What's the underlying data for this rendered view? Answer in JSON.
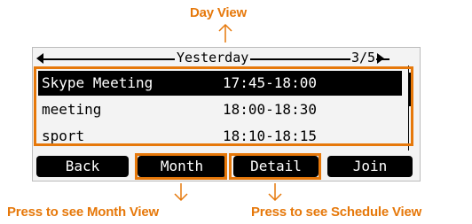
{
  "callouts": {
    "top": "Day View",
    "bottom_left": "Press to see Month View",
    "bottom_right": "Press to see Schedule View"
  },
  "screen": {
    "title": "Yesterday",
    "page_indicator": "3/5",
    "events": [
      {
        "name": "Skype Meeting",
        "time": "17:45-18:00",
        "selected": true
      },
      {
        "name": "meeting",
        "time": "18:00-18:30",
        "selected": false
      },
      {
        "name": "sport",
        "time": "18:10-18:15",
        "selected": false
      }
    ],
    "softkeys": [
      "Back",
      "Month",
      "Detail",
      "Join"
    ]
  },
  "colors": {
    "accent": "#e6780a",
    "lcd_background": "#f3f3f3",
    "selection": "#000000"
  }
}
